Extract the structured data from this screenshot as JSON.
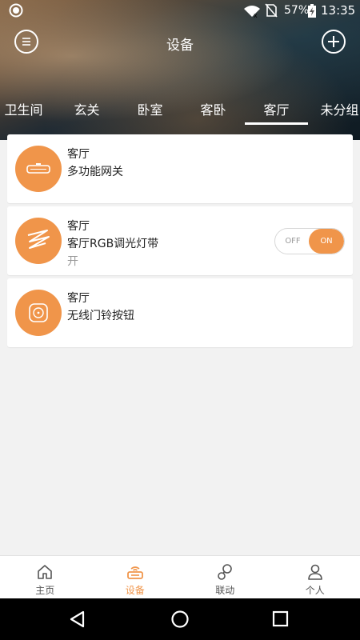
{
  "status_bar": {
    "battery": "57%",
    "time": "13:35"
  },
  "header": {
    "title": "设备"
  },
  "tabs": [
    {
      "label": "卫生间",
      "active": false
    },
    {
      "label": "玄关",
      "active": false
    },
    {
      "label": "卧室",
      "active": false
    },
    {
      "label": "客卧",
      "active": false
    },
    {
      "label": "客厅",
      "active": true
    },
    {
      "label": "未分组",
      "active": false
    }
  ],
  "devices": [
    {
      "room": "客厅",
      "name": "多功能网关",
      "status": "",
      "icon": "gateway-icon"
    },
    {
      "room": "客厅",
      "name": "客厅RGB调光灯带",
      "status": "开",
      "icon": "light-strip-icon",
      "toggle": {
        "off": "OFF",
        "on": "ON",
        "state": "on"
      }
    },
    {
      "room": "客厅",
      "name": "无线门铃按钮",
      "status": "",
      "icon": "doorbell-button-icon"
    }
  ],
  "bottom_nav": [
    {
      "label": "主页",
      "icon": "home-icon",
      "active": false
    },
    {
      "label": "设备",
      "icon": "device-icon",
      "active": true
    },
    {
      "label": "联动",
      "icon": "link-icon",
      "active": false
    },
    {
      "label": "个人",
      "icon": "person-icon",
      "active": false
    }
  ],
  "colors": {
    "accent": "#f0954a",
    "background": "#f2f2f2",
    "card": "#ffffff"
  }
}
